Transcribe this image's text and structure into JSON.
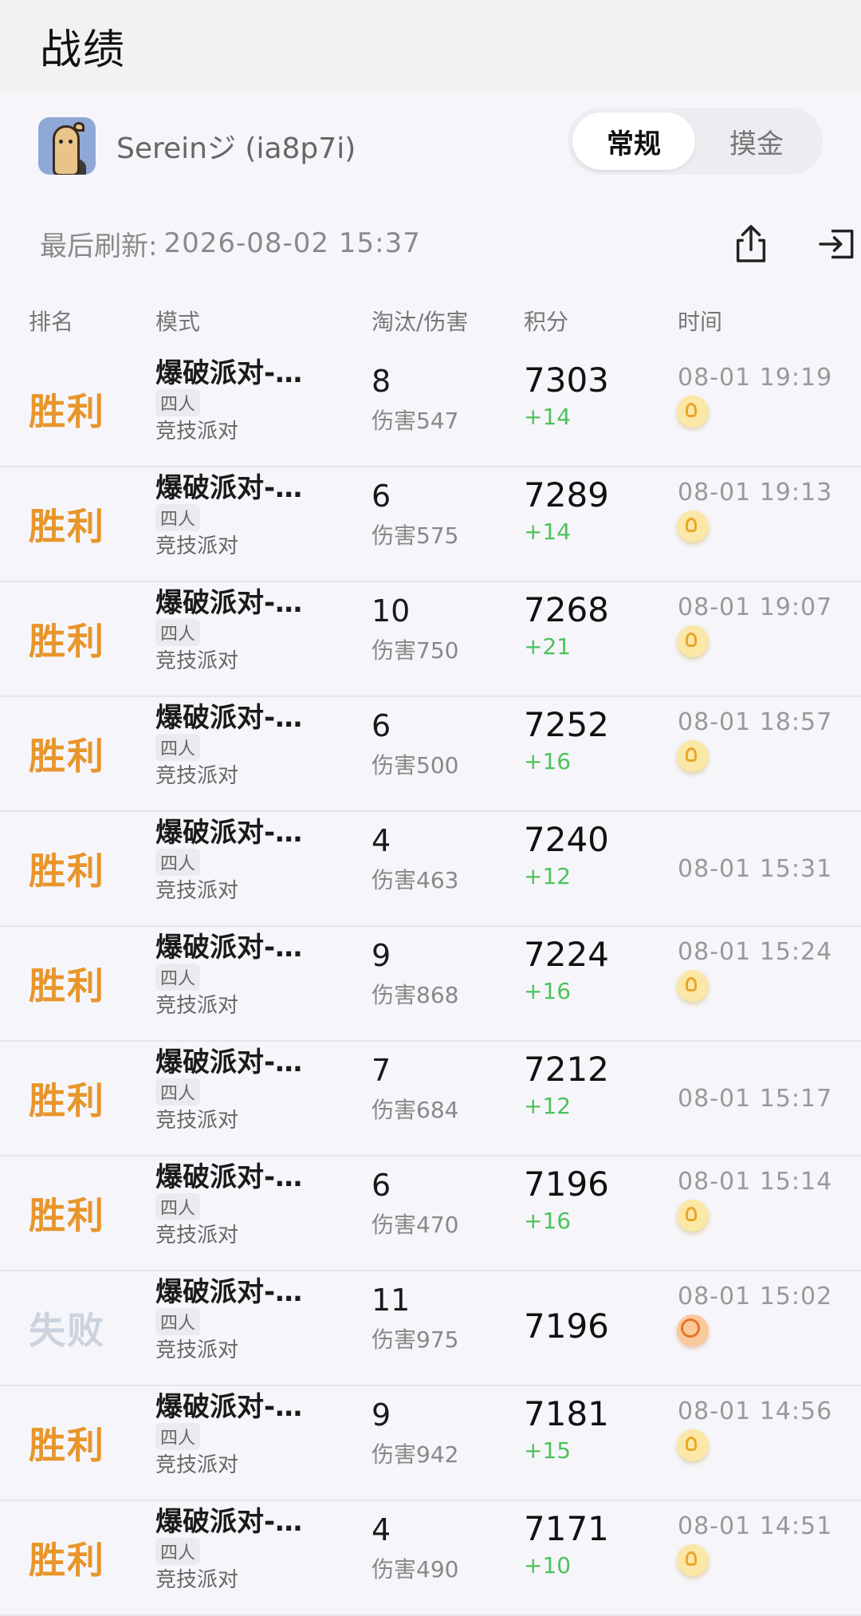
{
  "page": {
    "title": "战绩"
  },
  "profile": {
    "username": "Sereinジ (ia8p7i)",
    "tabs": [
      {
        "label": "常规",
        "active": true
      },
      {
        "label": "摸金",
        "active": false
      }
    ]
  },
  "refresh": {
    "label": "最后刷新:",
    "time": "2026-08-02 15:37"
  },
  "table": {
    "headers": {
      "rank": "排名",
      "mode": "模式",
      "kills": "淘汰/伤害",
      "score": "积分",
      "time": "时间"
    },
    "rows": [
      {
        "result": "胜利",
        "mode_title": "爆破派对-…",
        "mode_tag": "四人",
        "mode_sub": "竞技派对",
        "kills": "8",
        "damage": "伤害547",
        "score": "7303",
        "delta": "+14",
        "time": "08-01 19:19",
        "badge": "medal-icon"
      },
      {
        "result": "胜利",
        "mode_title": "爆破派对-…",
        "mode_tag": "四人",
        "mode_sub": "竞技派对",
        "kills": "6",
        "damage": "伤害575",
        "score": "7289",
        "delta": "+14",
        "time": "08-01 19:13",
        "badge": "medal-icon"
      },
      {
        "result": "胜利",
        "mode_title": "爆破派对-…",
        "mode_tag": "四人",
        "mode_sub": "竞技派对",
        "kills": "10",
        "damage": "伤害750",
        "score": "7268",
        "delta": "+21",
        "time": "08-01 19:07",
        "badge": "medal-icon"
      },
      {
        "result": "胜利",
        "mode_title": "爆破派对-…",
        "mode_tag": "四人",
        "mode_sub": "竞技派对",
        "kills": "6",
        "damage": "伤害500",
        "score": "7252",
        "delta": "+16",
        "time": "08-01 18:57",
        "badge": "medal-icon"
      },
      {
        "result": "胜利",
        "mode_title": "爆破派对-…",
        "mode_tag": "四人",
        "mode_sub": "竞技派对",
        "kills": "4",
        "damage": "伤害463",
        "score": "7240",
        "delta": "+12",
        "time": "08-01 15:31",
        "badge": ""
      },
      {
        "result": "胜利",
        "mode_title": "爆破派对-…",
        "mode_tag": "四人",
        "mode_sub": "竞技派对",
        "kills": "9",
        "damage": "伤害868",
        "score": "7224",
        "delta": "+16",
        "time": "08-01 15:24",
        "badge": "medal-icon"
      },
      {
        "result": "胜利",
        "mode_title": "爆破派对-…",
        "mode_tag": "四人",
        "mode_sub": "竞技派对",
        "kills": "7",
        "damage": "伤害684",
        "score": "7212",
        "delta": "+12",
        "time": "08-01 15:17",
        "badge": ""
      },
      {
        "result": "胜利",
        "mode_title": "爆破派对-…",
        "mode_tag": "四人",
        "mode_sub": "竞技派对",
        "kills": "6",
        "damage": "伤害470",
        "score": "7196",
        "delta": "+16",
        "time": "08-01 15:14",
        "badge": "medal-icon"
      },
      {
        "result": "失败",
        "mode_title": "爆破派对-…",
        "mode_tag": "四人",
        "mode_sub": "竞技派对",
        "kills": "11",
        "damage": "伤害975",
        "score": "7196",
        "delta": "",
        "time": "08-01 15:02",
        "badge": "smile-icon"
      },
      {
        "result": "胜利",
        "mode_title": "爆破派对-…",
        "mode_tag": "四人",
        "mode_sub": "竞技派对",
        "kills": "9",
        "damage": "伤害942",
        "score": "7181",
        "delta": "+15",
        "time": "08-01 14:56",
        "badge": "medal-icon"
      },
      {
        "result": "胜利",
        "mode_title": "爆破派对-…",
        "mode_tag": "四人",
        "mode_sub": "竞技派对",
        "kills": "4",
        "damage": "伤害490",
        "score": "7171",
        "delta": "+10",
        "time": "08-01 14:51",
        "badge": "medal-icon"
      }
    ]
  },
  "colors": {
    "win": "#e8952b",
    "lose": "#cbd3de",
    "delta": "#4cc25c"
  }
}
